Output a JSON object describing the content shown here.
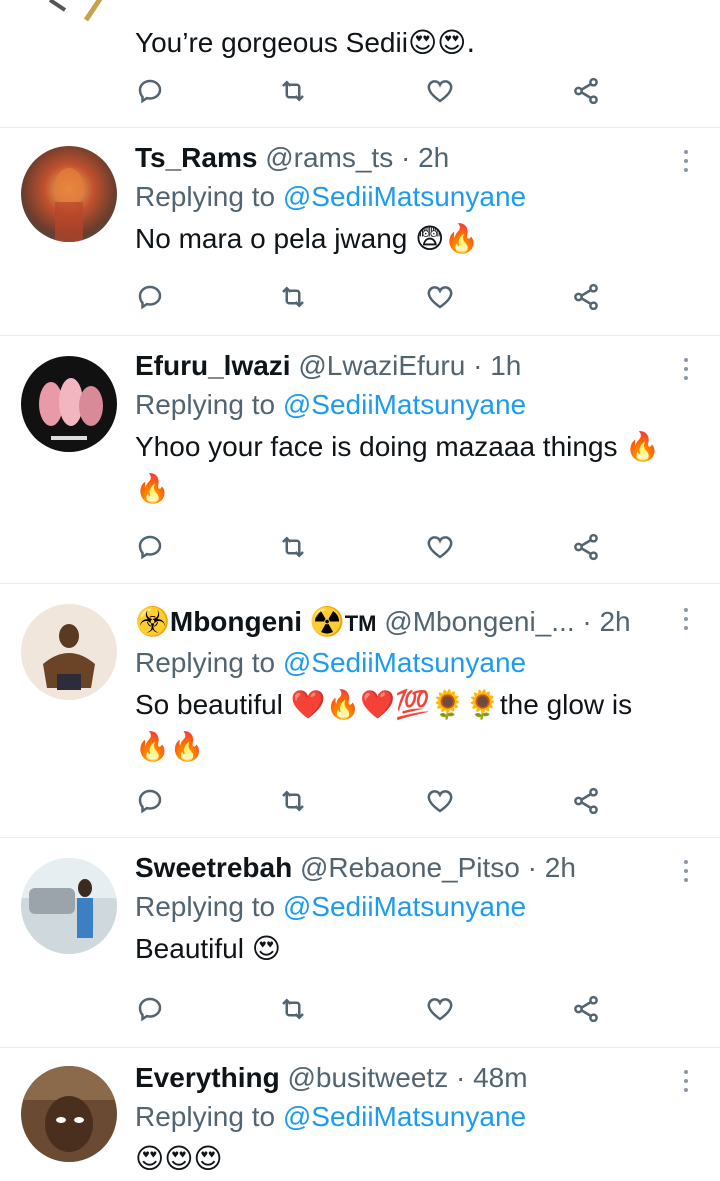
{
  "top_tweet": {
    "text": "You’re gorgeous Sedii",
    "emoji": "😍😍.",
    "actions": [
      "reply",
      "retweet",
      "like",
      "share"
    ]
  },
  "tweets": [
    {
      "name": "Ts_Rams",
      "handle": "@rams_ts",
      "dot": "·",
      "time": "2h",
      "reply_prefix": "Replying to",
      "mention": "@SediiMatsunyane",
      "text": "No mara o pela jwang",
      "emoji": "😨🔥"
    },
    {
      "name": "Efuru_lwazi",
      "handle": "@LwaziEfuru",
      "dot": "·",
      "time": "1h",
      "reply_prefix": "Replying to",
      "mention": "@SediiMatsunyane",
      "text": "Yhoo your face is doing mazaaa things",
      "emoji": "🔥",
      "emoji2": "🔥"
    },
    {
      "name": "Mbongeni",
      "name_prefix_emoji": "☣️",
      "name_suffix_emoji": "☢️",
      "name_suffix": "TM",
      "handle": "@Mbongeni_...",
      "dot": "·",
      "time": "2h",
      "reply_prefix": "Replying to",
      "mention": "@SediiMatsunyane",
      "text": "So beautiful",
      "emoji": "❤️🔥❤️💯🌻🌻",
      "text2": "the glow is",
      "emoji2": "🔥🔥"
    },
    {
      "name": "Sweetrebah",
      "handle": "@Rebaone_Pitso",
      "dot": "·",
      "time": "2h",
      "reply_prefix": "Replying to",
      "mention": "@SediiMatsunyane",
      "text": "Beautiful",
      "emoji": "😍"
    },
    {
      "name": "Everything",
      "handle": "@busitweetz",
      "dot": "·",
      "time": "48m",
      "reply_prefix": "Replying to",
      "mention": "@SediiMatsunyane",
      "text": "",
      "emoji": "😍😍😍"
    }
  ],
  "colors": {
    "link": "#1d9bf0",
    "secondary": "#536471",
    "divider": "#e6ecf0"
  },
  "icons": [
    "reply-icon",
    "retweet-icon",
    "like-icon",
    "share-icon",
    "more-icon"
  ]
}
